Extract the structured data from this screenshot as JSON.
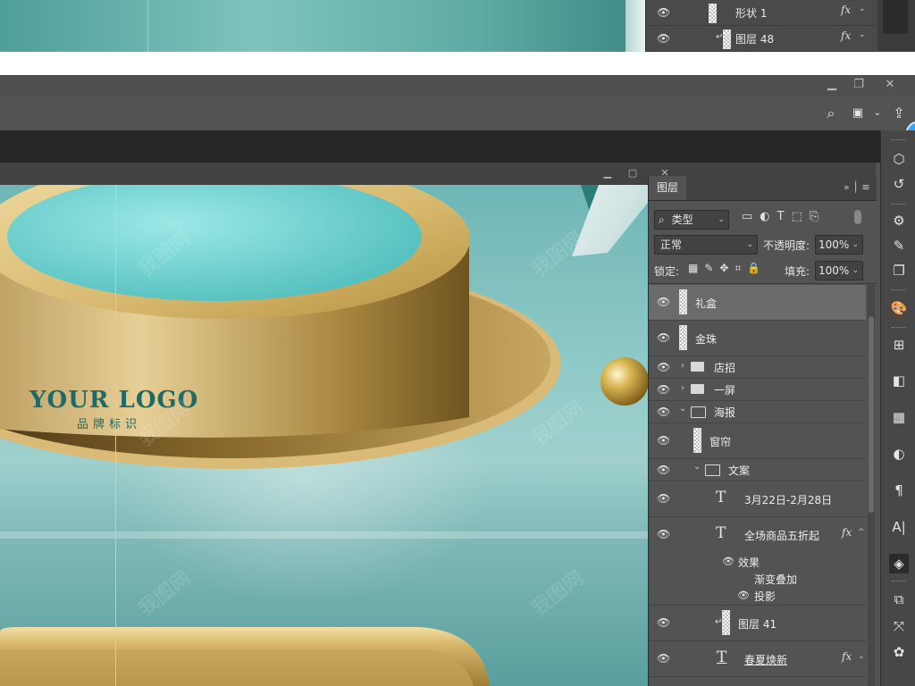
{
  "top_layers": [
    {
      "name": "形状 1",
      "fx": "fx"
    },
    {
      "name": "图层 48",
      "fx": "fx"
    }
  ],
  "window": {
    "minimize_icon": "minimize-icon",
    "restore_icon": "restore-icon",
    "close_icon": "close-icon"
  },
  "toolbar": {
    "search_icon": "search-icon",
    "workspace_icon": "workspace-icon",
    "share_icon": "share-icon"
  },
  "canvas": {
    "logo_text": "YOUR LOGO",
    "logo_subtitle": "品牌标识",
    "watermark": "我图网"
  },
  "layers_panel": {
    "tab_label": "图层",
    "filter_kind": "类型",
    "blend_mode": "正常",
    "opacity_label": "不透明度:",
    "opacity_value": "100%",
    "lock_label": "锁定:",
    "fill_label": "填充:",
    "fill_value": "100%",
    "layers": [
      {
        "name": "礼盒",
        "type": "pixel",
        "selected": true
      },
      {
        "name": "金珠",
        "type": "pixel"
      },
      {
        "name": "店招",
        "type": "group",
        "expanded": false
      },
      {
        "name": "一屏",
        "type": "group",
        "expanded": false
      },
      {
        "name": "海报",
        "type": "group",
        "expanded": true
      },
      {
        "name": "窗帘",
        "type": "pixel"
      },
      {
        "name": "文案",
        "type": "group",
        "expanded": true
      },
      {
        "name": "3月22日-2月28日",
        "type": "text"
      },
      {
        "name": "全场商品五折起",
        "type": "text",
        "fx": "fx"
      },
      {
        "name": "效果",
        "type": "effects"
      },
      {
        "name": "渐变叠加",
        "type": "effect"
      },
      {
        "name": "投影",
        "type": "effect"
      },
      {
        "name": "图层 41",
        "type": "pixel"
      },
      {
        "name": "春夏焕新",
        "type": "text",
        "fx": "fx"
      }
    ]
  },
  "colors": {
    "canvas_teal": "#8fc9c7",
    "gold": "#c9a75a",
    "logo": "#1f6a67",
    "accent_blue": "#3ba4ea"
  }
}
